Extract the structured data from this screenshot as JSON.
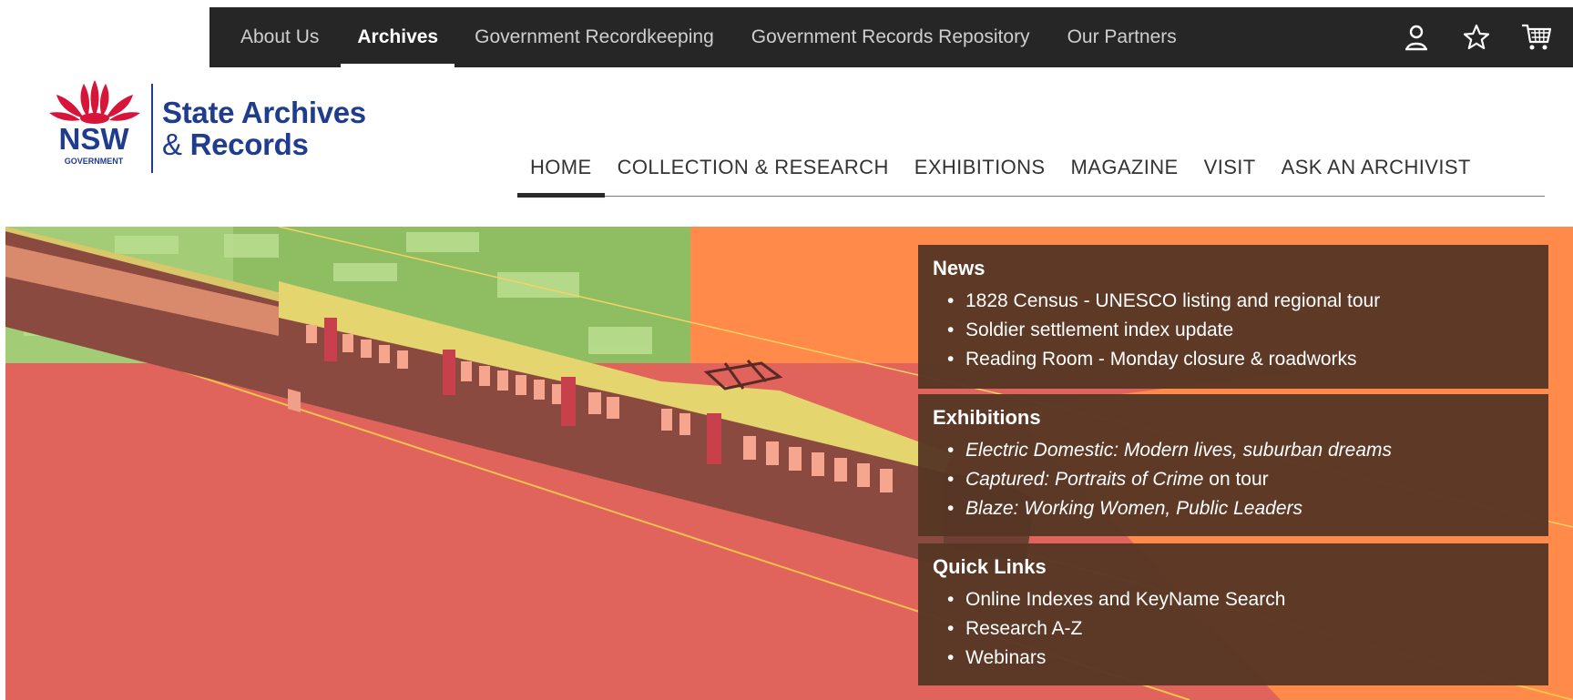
{
  "topbar": {
    "links": [
      {
        "label": "About Us",
        "active": false
      },
      {
        "label": "Archives",
        "active": true
      },
      {
        "label": "Government Recordkeeping",
        "active": false
      },
      {
        "label": "Government Records Repository",
        "active": false
      },
      {
        "label": "Our Partners",
        "active": false
      }
    ],
    "icons": [
      "user-icon",
      "star-icon",
      "cart-icon"
    ]
  },
  "logo": {
    "nsw_text": "NSW",
    "government_text": "GOVERNMENT",
    "line1": "State Archives",
    "line2_amp": "& ",
    "line2": "Records"
  },
  "mainnav": {
    "items": [
      {
        "label": "HOME",
        "active": true
      },
      {
        "label": "COLLECTION & RESEARCH",
        "active": false
      },
      {
        "label": "EXHIBITIONS",
        "active": false
      },
      {
        "label": "MAGAZINE",
        "active": false
      },
      {
        "label": "VISIT",
        "active": false
      },
      {
        "label": "ASK AN ARCHIVIST",
        "active": false
      }
    ]
  },
  "panels": {
    "news": {
      "title": "News",
      "items": [
        "1828 Census - UNESCO listing and regional tour",
        "Soldier settlement index update",
        "Reading Room - Monday closure & roadworks"
      ]
    },
    "exhibitions": {
      "title": "Exhibitions",
      "items": [
        {
          "italic": "Electric Domestic: Modern lives, suburban dreams",
          "rest": ""
        },
        {
          "italic": "Captured: Portraits of Crime",
          "rest": " on tour"
        },
        {
          "italic": "Blaze: Working Women, Public Leaders",
          "rest": ""
        }
      ]
    },
    "quicklinks": {
      "title": "Quick Links",
      "items": [
        "Online Indexes and KeyName Search",
        "Research A-Z",
        "Webinars"
      ]
    }
  },
  "colors": {
    "topbar_bg": "#262626",
    "brand_blue": "#1f3c8e",
    "waratah_red": "#d7153a",
    "hero_orange": "#ff8a4a",
    "hero_red": "#e0645c",
    "panel_bg": "#563624"
  }
}
